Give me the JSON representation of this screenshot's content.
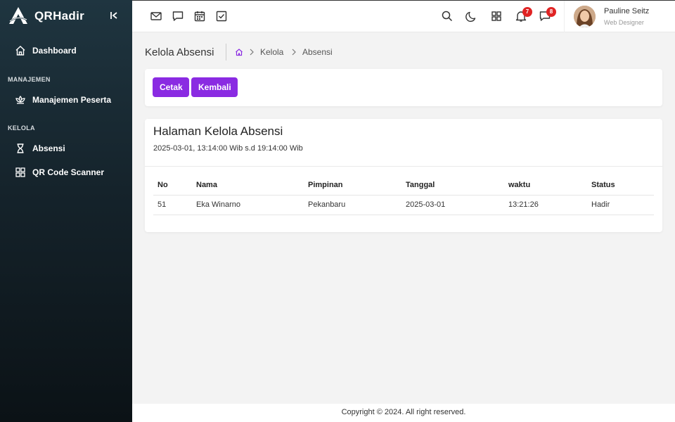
{
  "brand": {
    "name": "QRHadir"
  },
  "sidebar": {
    "dashboard": "Dashboard",
    "section_manajemen": "MANAJEMEN",
    "manajemen_peserta": "Manajemen Peserta",
    "section_kelola": "KELOLA",
    "absensi": "Absensi",
    "qr_scanner": "QR Code Scanner"
  },
  "topbar": {
    "notifications_count": "7",
    "messages_count": "8",
    "user": {
      "name": "Pauline Seitz",
      "role": "Web Designer"
    }
  },
  "breadcrumb": {
    "page_title": "Kelola Absensi",
    "level1": "Kelola",
    "level2": "Absensi"
  },
  "actions": {
    "print": "Cetak",
    "back": "Kembali"
  },
  "content": {
    "title": "Halaman Kelola Absensi",
    "subtitle": "2025-03-01, 13:14:00 Wib s.d 19:14:00 Wib"
  },
  "table": {
    "headers": [
      "No",
      "Nama",
      "Pimpinan",
      "Tanggal",
      "waktu",
      "Status"
    ],
    "rows": [
      [
        "51",
        "Eka Winarno",
        "Pekanbaru",
        "2025-03-01",
        "13:21:26",
        "Hadir"
      ]
    ]
  },
  "footer": {
    "text": "Copyright © 2024. All right reserved."
  }
}
